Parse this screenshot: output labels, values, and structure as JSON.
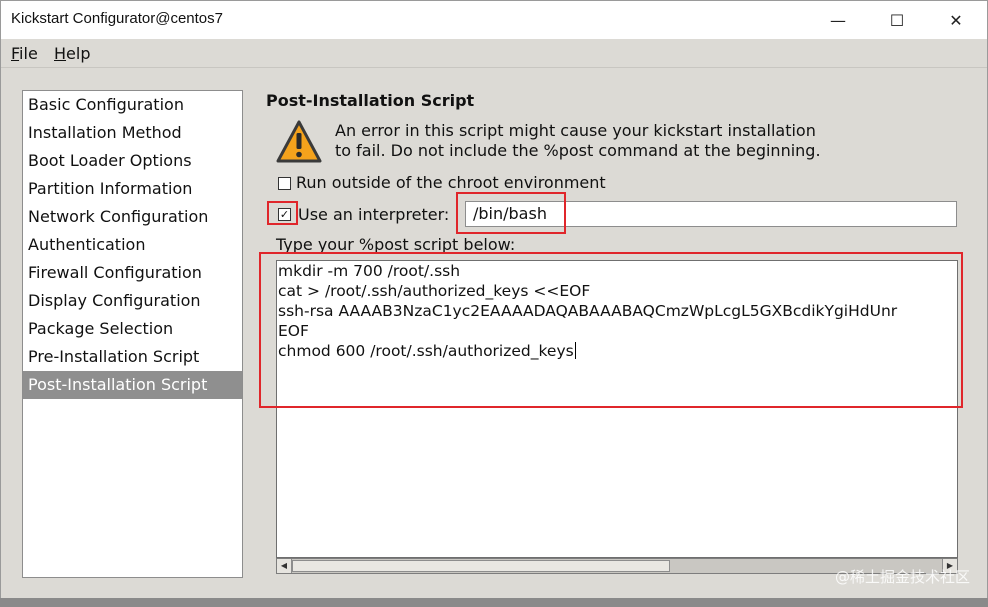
{
  "window": {
    "title": "Kickstart Configurator@centos7",
    "controls": {
      "minimize": "—",
      "maximize": "☐",
      "close": "✕"
    }
  },
  "menubar": {
    "file": {
      "accel": "F",
      "rest": "ile"
    },
    "help": {
      "accel": "H",
      "rest": "elp"
    }
  },
  "sidebar": {
    "items": [
      {
        "label": "Basic Configuration"
      },
      {
        "label": "Installation Method"
      },
      {
        "label": "Boot Loader Options"
      },
      {
        "label": "Partition Information"
      },
      {
        "label": "Network Configuration"
      },
      {
        "label": "Authentication"
      },
      {
        "label": "Firewall Configuration"
      },
      {
        "label": "Display Configuration"
      },
      {
        "label": "Package Selection"
      },
      {
        "label": "Pre-Installation Script"
      },
      {
        "label": "Post-Installation Script"
      }
    ],
    "selected": "Post-Installation Script"
  },
  "main": {
    "section_title": "Post-Installation Script",
    "warning_icon": "warning-triangle-icon",
    "warning_text_line1": "An error in this script might cause your kickstart installation",
    "warning_text_line2": "to fail. Do not include the %post command at the beginning.",
    "run_outside_chroot": {
      "label": "Run outside of the chroot environment",
      "checked": false
    },
    "use_interpreter": {
      "label": "Use an interpreter:",
      "checked": true,
      "mark": "✓"
    },
    "interpreter_value": "/bin/bash",
    "script_label": "Type your %post script below:",
    "script_lines": [
      "mkdir -m 700 /root/.ssh",
      "cat > /root/.ssh/authorized_keys <<EOF",
      "ssh-rsa AAAAB3NzaC1yc2EAAAADAQABAAABAQCmzWpLcgL5GXBcdikYgiHdUnr",
      "EOF",
      "chmod 600 /root/.ssh/authorized_keys"
    ]
  },
  "scrollbar": {
    "left_arrow": "◀",
    "right_arrow": "▶"
  },
  "watermark": "@稀土掘金技术社区",
  "colors": {
    "highlight": "#e0262b",
    "selected_bg": "#8f8f8f",
    "window_bg": "#dcdad5"
  }
}
